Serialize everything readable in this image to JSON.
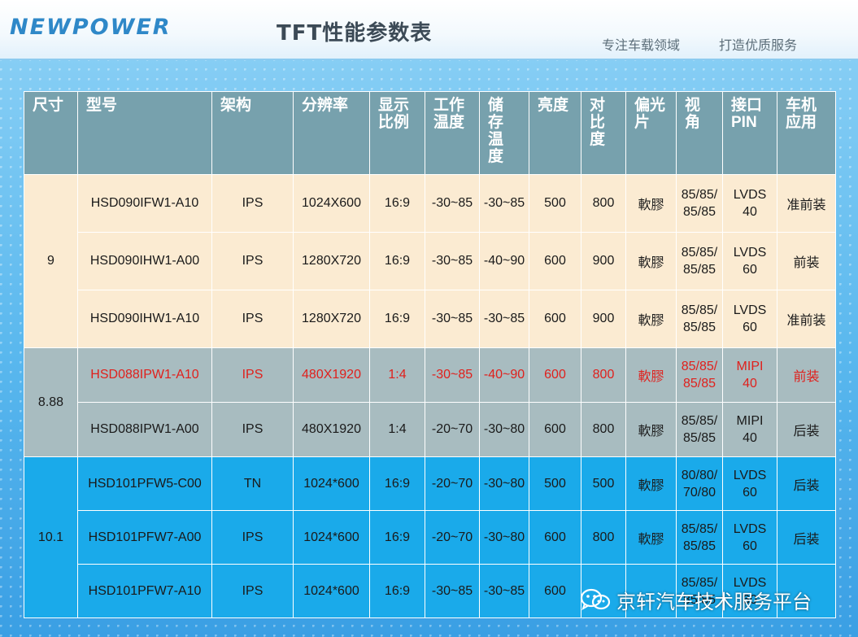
{
  "header": {
    "logo": "NEWPOWER",
    "title": "TFT性能参数表",
    "slogan_left": "专注车载领域",
    "slogan_right": "打造优质服务"
  },
  "table": {
    "columns": [
      "尺寸",
      "型号",
      "架构",
      "分辨率",
      "显示比例",
      "工作温度",
      "储存温度",
      "亮度",
      "对比度",
      "偏光片",
      "视角",
      "接口PIN",
      "车机应用"
    ],
    "column_lines": [
      [
        "尺寸"
      ],
      [
        "型号"
      ],
      [
        "架构"
      ],
      [
        "分辨率"
      ],
      [
        "显示",
        "比例"
      ],
      [
        "工作",
        "温度"
      ],
      [
        "储",
        "存",
        "温",
        "度"
      ],
      [
        "亮度"
      ],
      [
        "对",
        "比",
        "度"
      ],
      [
        "偏光",
        "片"
      ],
      [
        "视",
        "角"
      ],
      [
        "接口",
        "PIN"
      ],
      [
        "车机",
        "应用"
      ]
    ],
    "groups": [
      {
        "size": "9",
        "rows": [
          {
            "model": "HSD090IFW1-A10",
            "arch": "IPS",
            "res": "1024X600",
            "ratio": "16:9",
            "work": "-30~85",
            "store": "-30~85",
            "bright": "500",
            "contrast": "800",
            "polar": "軟膠",
            "view": [
              "85/85/",
              "85/85"
            ],
            "pin": [
              "LVDS",
              "40"
            ],
            "app": "准前装"
          },
          {
            "model": "HSD090IHW1-A00",
            "arch": "IPS",
            "res": "1280X720",
            "ratio": "16:9",
            "work": "-30~85",
            "store": "-40~90",
            "bright": "600",
            "contrast": "900",
            "polar": "軟膠",
            "view": [
              "85/85/",
              "85/85"
            ],
            "pin": [
              "LVDS",
              "60"
            ],
            "app": "前装"
          },
          {
            "model": "HSD090IHW1-A10",
            "arch": "IPS",
            "res": "1280X720",
            "ratio": "16:9",
            "work": "-30~85",
            "store": "-30~85",
            "bright": "600",
            "contrast": "900",
            "polar": "軟膠",
            "view": [
              "85/85/",
              "85/85"
            ],
            "pin": [
              "LVDS",
              "60"
            ],
            "app": "准前装"
          }
        ]
      },
      {
        "size": "8.88",
        "rows": [
          {
            "model": "HSD088IPW1-A10",
            "arch": "IPS",
            "res": "480X1920",
            "ratio": "1:4",
            "work": "-30~85",
            "store": "-40~90",
            "bright": "600",
            "contrast": "800",
            "polar": "軟膠",
            "view": [
              "85/85/",
              "85/85"
            ],
            "pin": [
              "MIPI",
              "40"
            ],
            "app": "前装",
            "highlight": true
          },
          {
            "model": "HSD088IPW1-A00",
            "arch": "IPS",
            "res": "480X1920",
            "ratio": "1:4",
            "work": "-20~70",
            "store": "-30~80",
            "bright": "600",
            "contrast": "800",
            "polar": "軟膠",
            "view": [
              "85/85/",
              "85/85"
            ],
            "pin": [
              "MIPI",
              "40"
            ],
            "app": "后装"
          }
        ]
      },
      {
        "size": "10.1",
        "rows": [
          {
            "model": "HSD101PFW5-C00",
            "arch": "TN",
            "res": "1024*600",
            "ratio": "16:9",
            "work": "-20~70",
            "store": "-30~80",
            "bright": "500",
            "contrast": "500",
            "polar": "軟膠",
            "view": [
              "80/80/",
              "70/80"
            ],
            "pin": [
              "LVDS",
              "60"
            ],
            "app": "后装"
          },
          {
            "model": "HSD101PFW7-A00",
            "arch": "IPS",
            "res": "1024*600",
            "ratio": "16:9",
            "work": "-20~70",
            "store": "-30~80",
            "bright": "600",
            "contrast": "800",
            "polar": "軟膠",
            "view": [
              "85/85/",
              "85/85"
            ],
            "pin": [
              "LVDS",
              "60"
            ],
            "app": "后装"
          },
          {
            "model": "HSD101PFW7-A10",
            "arch": "IPS",
            "res": "1024*600",
            "ratio": "16:9",
            "work": "-30~85",
            "store": "-30~85",
            "bright": "600",
            "contrast": "",
            "polar": "",
            "view": [
              "85/85/",
              "85/85"
            ],
            "pin": [
              "LVDS",
              "60"
            ],
            "app": ""
          }
        ]
      }
    ]
  },
  "watermark": {
    "icon": "wechat-icon",
    "text": "京轩汽车技术服务平台"
  },
  "colors": {
    "header_row": "#77a1ad",
    "group_9": "#fbebd2",
    "group_888": "#a8bcc0",
    "group_101": "#1aaaea",
    "highlight_text": "#e0201c"
  }
}
